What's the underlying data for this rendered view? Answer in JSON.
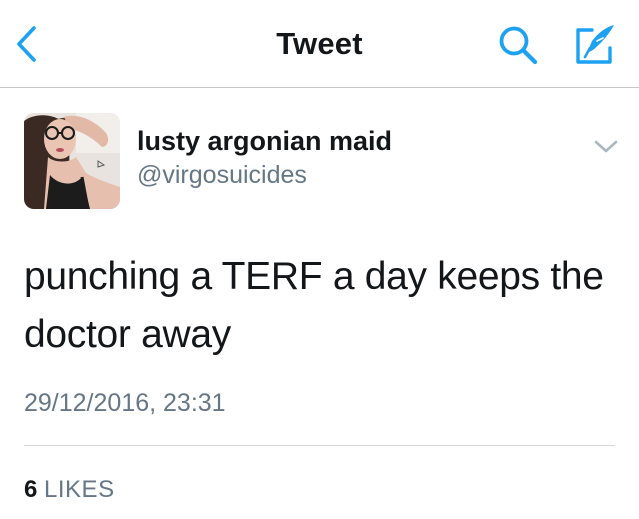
{
  "colors": {
    "accent": "#1da1f2",
    "text": "#14171a",
    "secondary": "#657786",
    "divider": "#d8d8dc"
  },
  "navbar": {
    "title": "Tweet",
    "back_icon": "chevron-left-icon",
    "search_icon": "search-icon",
    "compose_icon": "compose-tweet-icon"
  },
  "tweet": {
    "author": {
      "display_name": "lusty argonian maid",
      "handle": "@virgosuicides",
      "avatar_icon": "profile-photo"
    },
    "text_line_1": "punching a TERF a day keeps the",
    "text_line_2": "doctor away",
    "timestamp": "29/12/2016, 23:31",
    "menu_icon": "chevron-down-icon",
    "likes": {
      "count": "6",
      "label": "LIKES"
    }
  }
}
